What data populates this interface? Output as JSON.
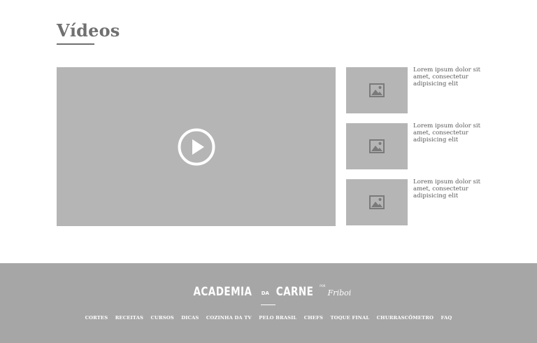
{
  "section": {
    "title": "Vídeos"
  },
  "main_video": {
    "icon": "play-icon"
  },
  "playlist": [
    {
      "icon": "image-placeholder-icon",
      "lines": [
        "Lorem ipsum dolor sit",
        "amet, consectetur",
        "adipisicing elit"
      ]
    },
    {
      "icon": "image-placeholder-icon",
      "lines": [
        "Lorem ipsum dolor sit",
        "amet, consectetur",
        "adipisicing elit"
      ]
    },
    {
      "icon": "image-placeholder-icon",
      "lines": [
        "Lorem ipsum dolor sit",
        "amet, consectetur",
        "adipisicing elit"
      ]
    }
  ],
  "footer": {
    "logo": {
      "word1": "ACADEMIA",
      "connector": "DA",
      "word2": "CARNE",
      "by": "POR",
      "signature": "Friboi"
    },
    "nav": [
      "CORTES",
      "RECEITAS",
      "CURSOS",
      "DICAS",
      "COZINHA DA TV",
      "PELO BRASIL",
      "CHEFS",
      "TOQUE FINAL",
      "CHURRASCÔMETRO",
      "FAQ"
    ]
  },
  "colors": {
    "placeholder": "#b5b5b5",
    "footer_bg": "#a6a6a6",
    "title": "#707070"
  }
}
